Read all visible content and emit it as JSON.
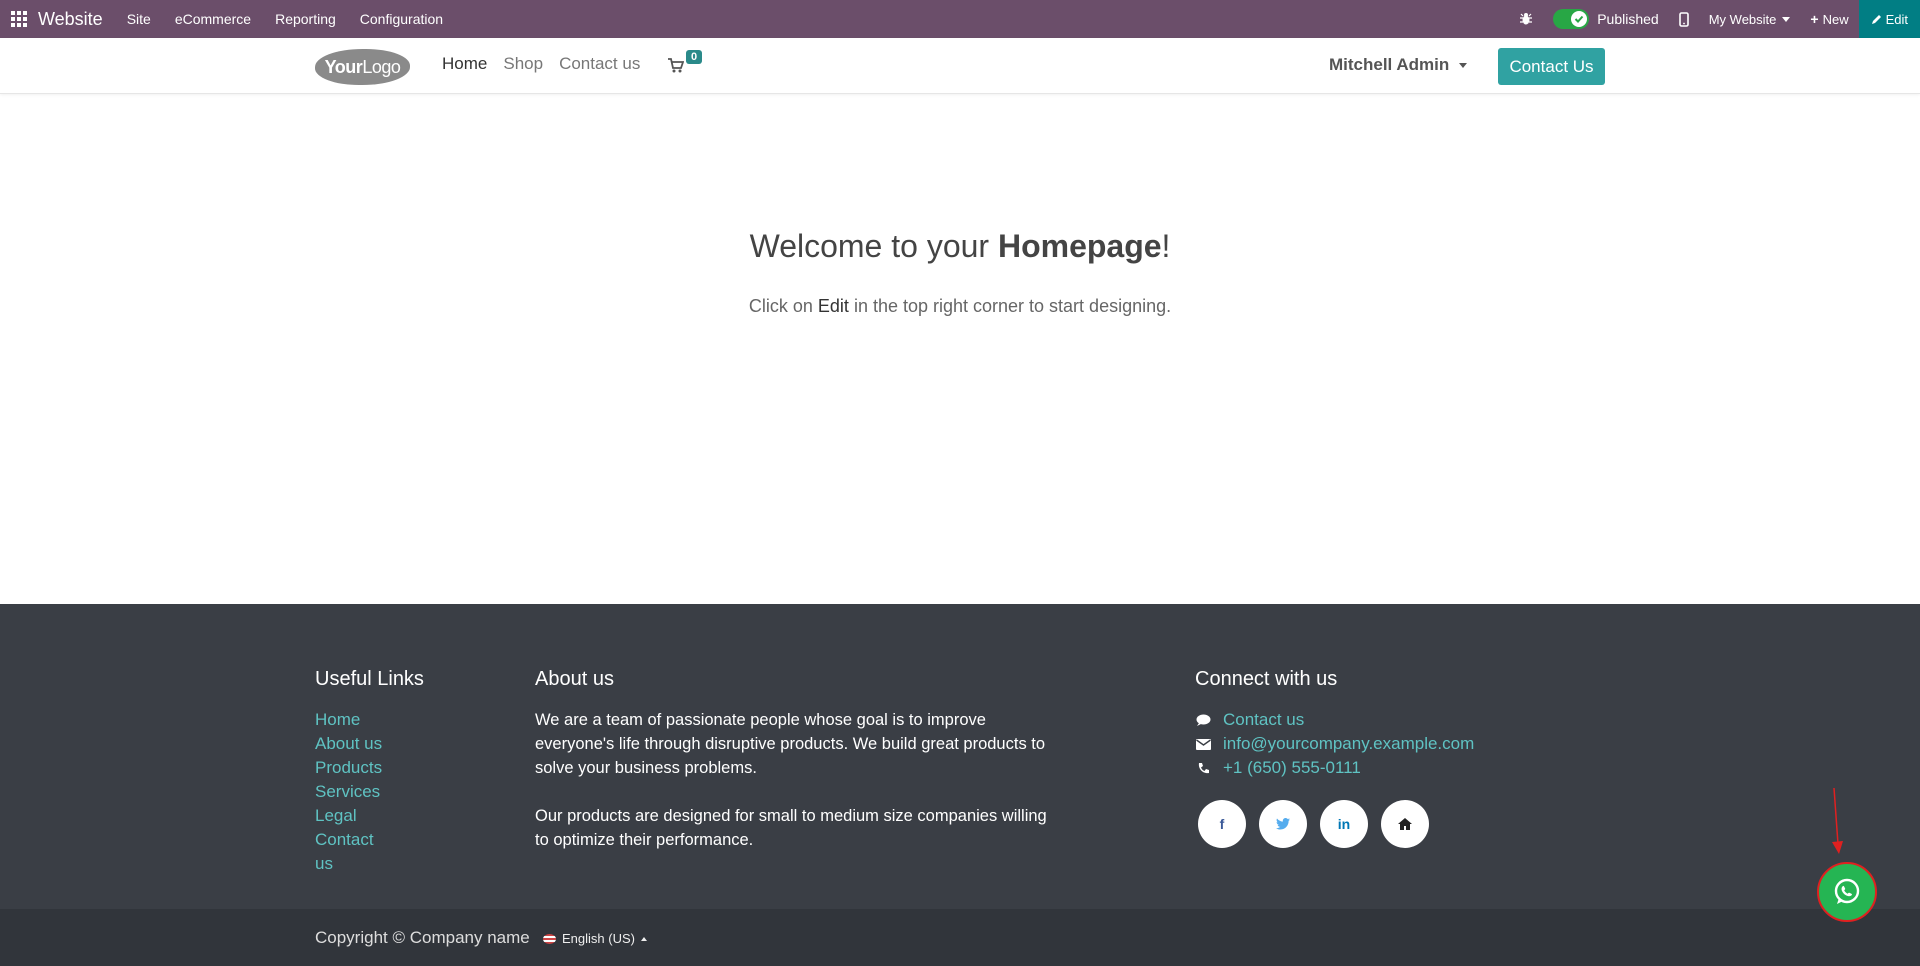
{
  "topbar": {
    "app_name": "Website",
    "menus": [
      "Site",
      "eCommerce",
      "Reporting",
      "Configuration"
    ],
    "published_label": "Published",
    "website_selector": "My Website",
    "new_label": "New",
    "edit_label": "Edit"
  },
  "header": {
    "logo_text_bold": "Your",
    "logo_text_thin": "Logo",
    "nav": [
      "Home",
      "Shop",
      "Contact us"
    ],
    "cart_count": "0",
    "user_name": "Mitchell Admin",
    "contact_button": "Contact Us"
  },
  "main": {
    "welcome_prefix": "Welcome to your ",
    "welcome_bold": "Homepage",
    "welcome_suffix": "!",
    "subtitle_prefix": "Click on ",
    "subtitle_em": "Edit",
    "subtitle_suffix": " in the top right corner to start designing."
  },
  "footer": {
    "useful_links_title": "Useful Links",
    "useful_links": [
      "Home",
      "About us",
      "Products",
      "Services",
      "Legal",
      "Contact us"
    ],
    "about_title": "About us",
    "about_p1": "We are a team of passionate people whose goal is to improve everyone's life through disruptive products. We build great products to solve your business problems.",
    "about_p2": "Our products are designed for small to medium size companies willing to optimize their performance.",
    "connect_title": "Connect with us",
    "contact_link": "Contact us",
    "email": "info@yourcompany.example.com",
    "phone": "+1 (650) 555-0111",
    "socials": [
      "facebook-icon",
      "twitter-icon",
      "linkedin-icon",
      "home-icon"
    ],
    "copyright": "Copyright © Company name",
    "language": "English (US)"
  },
  "colors": {
    "topbar": "#6b4e6a",
    "edit_button": "#017e84",
    "accent_teal": "#30a2a2",
    "footer_bg": "#3a3e45",
    "whatsapp": "#25b553"
  }
}
